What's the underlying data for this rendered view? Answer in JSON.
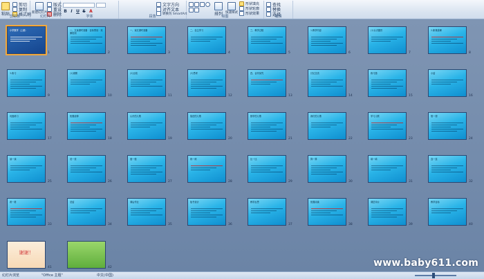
{
  "ribbon": {
    "clipboard": {
      "paste": "粘贴",
      "cut": "剪切",
      "copy": "复制",
      "format_painter": "格式刷",
      "label": "剪贴板"
    },
    "slides": {
      "new_slide": "新建幻灯片",
      "layout": "版式",
      "reset": "重设",
      "delete": "删除",
      "label": "幻灯片"
    },
    "font": {
      "family": "",
      "size": "",
      "label": "字体",
      "buttons": [
        "B",
        "I",
        "U",
        "S",
        "A"
      ]
    },
    "paragraph": {
      "label": "段落",
      "text_direction": "文字方向",
      "align_text": "对齐文本",
      "smartart": "转换为 SmartArt"
    },
    "drawing": {
      "arrange": "排列",
      "quick_styles": "快速样式",
      "shape_fill": "形状填充",
      "shape_outline": "形状轮廓",
      "shape_effects": "形状效果",
      "label": "绘图"
    },
    "editing": {
      "find": "查找",
      "replace": "替换",
      "select": "选择",
      "label": "编辑"
    }
  },
  "slides": [
    {
      "n": 1,
      "style": "dark",
      "text": "小学数学（上册）"
    },
    {
      "n": 2,
      "style": "",
      "text": "一、文读课时准备 · 目标预设 · 效果检测"
    },
    {
      "n": 3,
      "style": "",
      "text": "一、读文课时准备"
    },
    {
      "n": 4,
      "style": "",
      "text": "二、自主学习"
    },
    {
      "n": 5,
      "style": "",
      "text": "三、教学过程"
    },
    {
      "n": 6,
      "style": "",
      "text": "1.教学内容"
    },
    {
      "n": 7,
      "style": "",
      "text": "(1)认识图形"
    },
    {
      "n": 8,
      "style": "",
      "text": "2.新课讲解"
    },
    {
      "n": 9,
      "style": "",
      "text": "3.练习"
    },
    {
      "n": 10,
      "style": "",
      "text": "(1)观察"
    },
    {
      "n": 11,
      "style": "",
      "text": "(2)比较"
    },
    {
      "n": 12,
      "style": "",
      "text": "(3)思考"
    },
    {
      "n": 13,
      "style": "",
      "text": "四、合作探究"
    },
    {
      "n": 14,
      "style": "",
      "text": "讨论交流"
    },
    {
      "n": 15,
      "style": "",
      "text": "练习题"
    },
    {
      "n": 16,
      "style": "",
      "text": "小结"
    },
    {
      "n": 17,
      "style": "",
      "text": "巩固练习"
    },
    {
      "n": 18,
      "style": "",
      "text": "拓展延伸"
    },
    {
      "n": 19,
      "style": "",
      "text": "认识的儿歌"
    },
    {
      "n": 20,
      "style": "",
      "text": "描述的儿歌"
    },
    {
      "n": 21,
      "style": "",
      "text": "数学的儿歌"
    },
    {
      "n": 22,
      "style": "",
      "text": "我们的儿歌"
    },
    {
      "n": 23,
      "style": "",
      "text": "学习儿歌"
    },
    {
      "n": 24,
      "style": "",
      "text": "想一想"
    },
    {
      "n": 25,
      "style": "",
      "text": "读一读"
    },
    {
      "n": 26,
      "style": "",
      "text": "说一说"
    },
    {
      "n": 27,
      "style": "",
      "text": "做一做"
    },
    {
      "n": 28,
      "style": "",
      "text": "练一练"
    },
    {
      "n": 29,
      "style": "",
      "text": "比一比"
    },
    {
      "n": 30,
      "style": "",
      "text": "算一算"
    },
    {
      "n": 31,
      "style": "",
      "text": "填一填"
    },
    {
      "n": 32,
      "style": "",
      "text": "连一连"
    },
    {
      "n": 33,
      "style": "",
      "text": "看一看"
    },
    {
      "n": 34,
      "style": "",
      "text": "总结"
    },
    {
      "n": 35,
      "style": "",
      "text": "课后作业"
    },
    {
      "n": 36,
      "style": "",
      "text": "板书设计"
    },
    {
      "n": 37,
      "style": "",
      "text": "教学反思"
    },
    {
      "n": 38,
      "style": "",
      "text": "拓展阅读"
    },
    {
      "n": 39,
      "style": "",
      "text": "课堂评价"
    },
    {
      "n": 40,
      "style": "",
      "text": "教学目标"
    },
    {
      "n": 41,
      "style": "pale",
      "text": "谢谢！"
    },
    {
      "n": 42,
      "style": "green",
      "text": ""
    }
  ],
  "watermark": "www.baby611.com",
  "status": {
    "slide_view": "幻灯片浏览",
    "theme": "\"Office 主题\"",
    "language": "中文(中国)"
  }
}
